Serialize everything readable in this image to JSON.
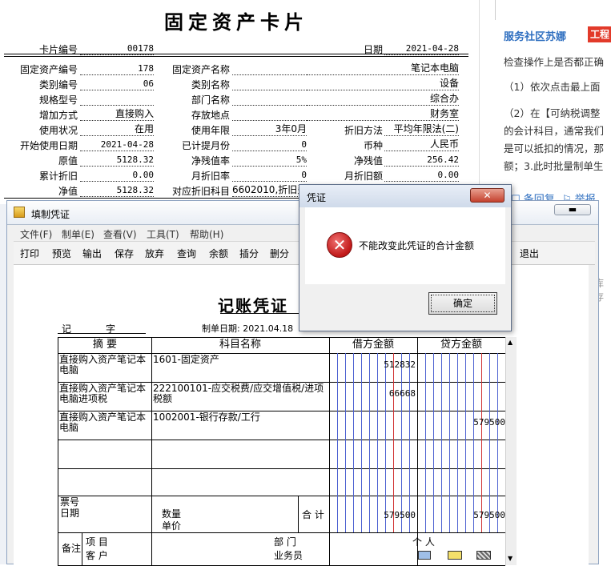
{
  "card": {
    "title": "固定资产卡片",
    "rows": [
      {
        "l1": "卡片编号",
        "v1": "00178",
        "l2": "",
        "v2": "",
        "l3": "日期",
        "v3": "2021-04-28"
      },
      {
        "l1": "固定资产编号",
        "v1": "178",
        "l2": "固定资产名称",
        "v2": "",
        "l3": "",
        "v3": "笔记本电脑"
      },
      {
        "l1": "类别编号",
        "v1": "06",
        "l2": "类别名称",
        "v2": "",
        "l3": "",
        "v3": "设备"
      },
      {
        "l1": "规格型号",
        "v1": "",
        "l2": "部门名称",
        "v2": "",
        "l3": "",
        "v3": "综合办"
      },
      {
        "l1": "增加方式",
        "v1": "直接购入",
        "l2": "存放地点",
        "v2": "",
        "l3": "",
        "v3": "财务室"
      },
      {
        "l1": "使用状况",
        "v1": "在用",
        "l2": "使用年限",
        "v2": "3年0月",
        "l3": "折旧方法",
        "v3": "平均年限法(二)"
      },
      {
        "l1": "开始使用日期",
        "v1": "2021-04-28",
        "l2": "已计提月份",
        "v2": "0",
        "l3": "币种",
        "v3": "人民币"
      },
      {
        "l1": "原值",
        "v1": "5128.32",
        "l2": "净残值率",
        "v2": "5%",
        "l3": "净残值",
        "v3": "256.42"
      },
      {
        "l1": "累计折旧",
        "v1": "0.00",
        "l2": "月折旧率",
        "v2": "0",
        "l3": "月折旧额",
        "v3": "0.00"
      },
      {
        "l1": "净值",
        "v1": "5128.32",
        "l2": "对应折旧科目",
        "v2": "6602010,折旧费",
        "l3": "",
        "v3": ""
      }
    ]
  },
  "right_panel": {
    "header": "服务社区苏娜",
    "badge": "工程",
    "lines": [
      "检查操作上是否都正确",
      "（1）依次点击最上面",
      "（2）在【可纳税调整",
      "的会计科目，通常我们",
      "是可以抵扣的情况，那",
      "额；3.此时批量制单生"
    ],
    "actions": [
      "条回复",
      "举报"
    ],
    "faint": "库存"
  },
  "voucher_window": {
    "title": "填制凭证",
    "menu": [
      "文件(F)",
      "制单(E)",
      "查看(V)",
      "工具(T)",
      "帮助(H)"
    ],
    "toolbar": [
      "打印",
      "预览",
      "输出",
      "保存",
      "放弃",
      "查询",
      "余额",
      "插分",
      "删分",
      "",
      "",
      "",
      "",
      "",
      "退出"
    ],
    "voucher_title": "记账凭证",
    "ji_label": "记",
    "zi_label": "字",
    "date_label": "制单日期: 2021.04.18",
    "headers": {
      "summary": "摘  要",
      "account": "科目名称",
      "debit": "借方金额",
      "credit": "贷方金额"
    },
    "rows": [
      {
        "summary": "直接购入资产笔记本电脑",
        "account": "1601-固定资产",
        "debit": "512832",
        "credit": ""
      },
      {
        "summary": "直接购入资产笔记本电脑进项税",
        "account": "222100101-应交税费/应交增值税/进项税额",
        "debit": "66668",
        "credit": ""
      },
      {
        "summary": "直接购入资产笔记本电脑",
        "account": "1002001-银行存款/工行",
        "debit": "",
        "credit": "579500"
      },
      {
        "summary": "",
        "account": "",
        "debit": "",
        "credit": ""
      },
      {
        "summary": "",
        "account": "",
        "debit": "",
        "credit": ""
      }
    ],
    "footer": {
      "ticket_no": "票号",
      "date": "日期",
      "quantity": "数量",
      "unit_price": "单价",
      "total_label": "合 计",
      "total_debit": "579500",
      "total_credit": "579500",
      "remark": "备注",
      "project": "项  目",
      "customer": "客  户",
      "department": "部  门",
      "salesperson": "业务员",
      "person": "个  人"
    }
  },
  "dialog": {
    "title": "凭证",
    "message": "不能改变此凭证的合计金额",
    "ok": "确定",
    "close": "✕"
  }
}
